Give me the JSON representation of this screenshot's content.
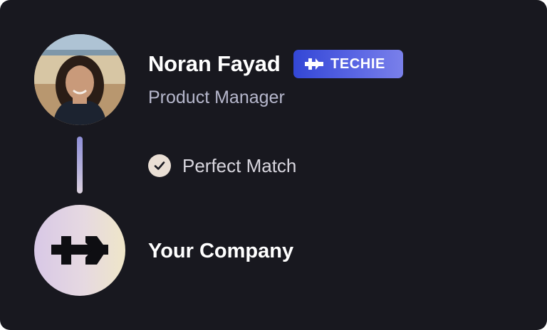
{
  "candidate": {
    "name": "Noran Fayad",
    "role": "Product Manager",
    "badge_label": "TECHIE",
    "badge_icon": "brand-logo-icon",
    "avatar": "profile-photo"
  },
  "match": {
    "label": "Perfect Match",
    "icon": "check-circle-icon"
  },
  "company": {
    "name": "Your Company",
    "logo_icon": "brand-logo-icon"
  },
  "colors": {
    "background": "#18181f",
    "badge_start": "#3347d6",
    "badge_end": "#7a80ea",
    "role_text": "#b6b7cc"
  }
}
